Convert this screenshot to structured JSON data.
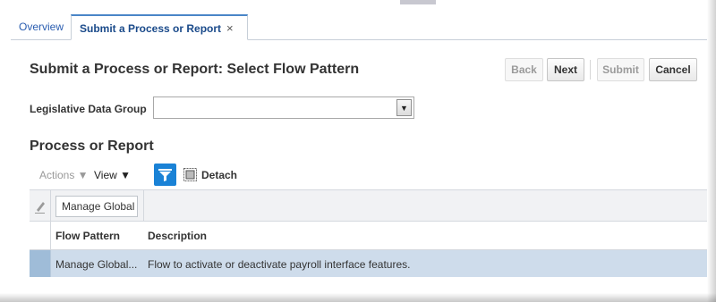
{
  "tabs": {
    "overview": "Overview",
    "active": "Submit a Process or Report",
    "close_symbol": "×"
  },
  "header": {
    "title": "Submit a Process or Report: Select Flow Pattern",
    "buttons": {
      "back": "Back",
      "next": "Next",
      "submit": "Submit",
      "cancel": "Cancel"
    }
  },
  "form": {
    "ldg_label": "Legislative Data Group",
    "ldg_value": ""
  },
  "section": {
    "title": "Process or Report"
  },
  "toolbar": {
    "actions": "Actions ▼",
    "view": "View ▼",
    "detach": "Detach"
  },
  "table": {
    "filter_value": "Manage Global",
    "columns": [
      "Flow Pattern",
      "Description"
    ],
    "rows": [
      {
        "flow_pattern": "Manage Global...",
        "description": "Flow to activate or deactivate payroll interface features."
      }
    ]
  },
  "colors": {
    "tab_accent": "#4a86c8",
    "filter_button": "#1a82d6",
    "selected_row": "#cedceb"
  },
  "icons": [
    "pencil-icon",
    "filter-icon",
    "detach-icon",
    "dropdown-arrow-icon",
    "close-icon"
  ]
}
